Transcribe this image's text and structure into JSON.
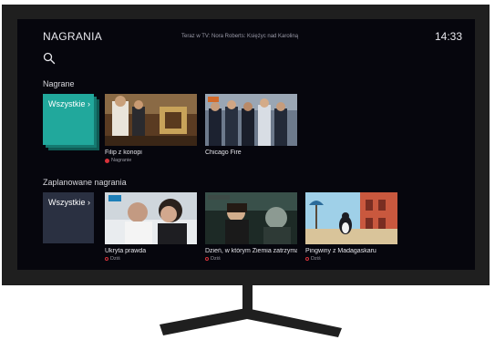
{
  "header": {
    "title": "NAGRANIA",
    "now_playing": "Teraz w TV: Nora Roberts: Księżyc nad Karoliną",
    "clock": "14:33"
  },
  "recorded": {
    "section_title": "Nagrane",
    "all_label": "Wszystkie ›",
    "cards": [
      {
        "title": "Filip z konopi",
        "status": "Nagranie"
      },
      {
        "title": "Chicago Fire",
        "status": ""
      }
    ]
  },
  "scheduled": {
    "section_title": "Zaplanowane nagrania",
    "all_label": "Wszystkie ›",
    "cards": [
      {
        "title": "Ukryta prawda",
        "status": "Dziś"
      },
      {
        "title": "Dzień, w którym Ziemia zatrzymała się",
        "status": "Dziś"
      },
      {
        "title": "Pingwiny z Madagaskaru",
        "status": "Dziś"
      }
    ]
  },
  "icons": {
    "search": "search-icon",
    "recording_dot": "recording-dot-icon",
    "scheduled_ring": "scheduled-ring-icon"
  },
  "colors": {
    "accent_teal": "#21a89c",
    "record_red": "#d8323a",
    "screen_bg": "#06060d"
  }
}
